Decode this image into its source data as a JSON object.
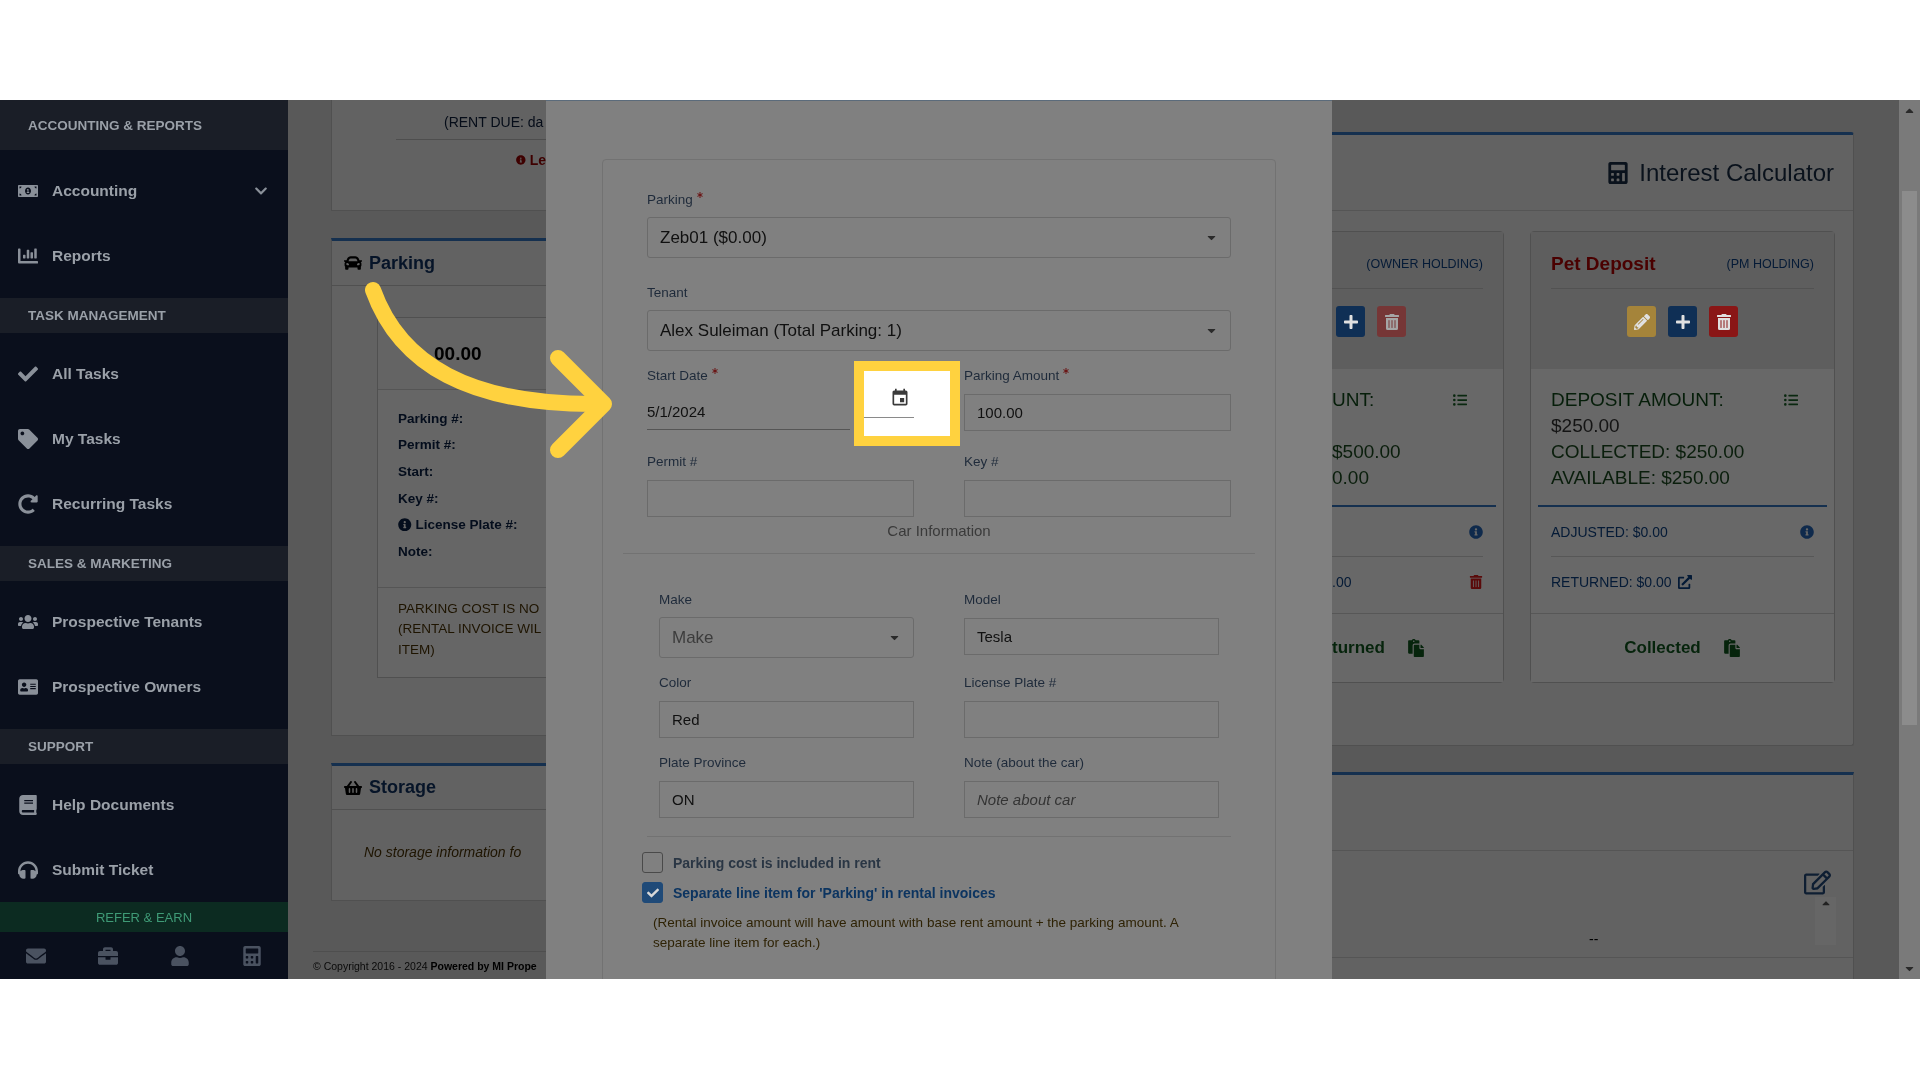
{
  "sidebar": {
    "sections": [
      {
        "title": "ACCOUNTING & REPORTS",
        "items": [
          {
            "label": "Accounting",
            "kind": "group"
          },
          {
            "label": "Reports",
            "kind": "link"
          }
        ]
      },
      {
        "title": "TASK MANAGEMENT",
        "items": [
          {
            "label": "All Tasks",
            "kind": "link"
          },
          {
            "label": "My Tasks",
            "kind": "link"
          },
          {
            "label": "Recurring Tasks",
            "kind": "link"
          }
        ]
      },
      {
        "title": "SALES & MARKETING",
        "items": [
          {
            "label": "Prospective Tenants",
            "kind": "link"
          },
          {
            "label": "Prospective Owners",
            "kind": "link"
          }
        ]
      },
      {
        "title": "SUPPORT",
        "items": [
          {
            "label": "Help Documents",
            "kind": "link"
          },
          {
            "label": "Submit Ticket",
            "kind": "link"
          }
        ]
      }
    ],
    "refer": "REFER & EARN"
  },
  "rent_card": {
    "rent_due": "(RENT DUE: da",
    "notice": "Le"
  },
  "parking_card": {
    "title": "Parking",
    "amount": "00.00",
    "fields": [
      {
        "label": "Parking #:",
        "kind": "plain"
      },
      {
        "label": "Permit #:",
        "kind": "plain"
      },
      {
        "label": "Start:",
        "kind": "plain"
      },
      {
        "label": "Key #:",
        "kind": "plain"
      },
      {
        "label": "License Plate #:",
        "kind": "info"
      },
      {
        "label": "Note:",
        "kind": "plain"
      }
    ],
    "warning_lines": [
      "PARKING COST IS NO",
      "(RENTAL INVOICE WIL",
      "ITEM)"
    ]
  },
  "storage_card": {
    "title": "Storage",
    "empty": "No storage information fo"
  },
  "footer": "© Copyright 2016 - 2024 **Powered by MI Prope**",
  "modal": {
    "top_fields": [
      {
        "label": "Parking",
        "required": true,
        "kind": "select",
        "value": "Zeb01 ($0.00)"
      },
      {
        "label": "Tenant",
        "required": false,
        "kind": "select",
        "value": "Alex Suleiman (Total Parking: 1)"
      }
    ],
    "row_fields": [
      {
        "label": "Start Date",
        "required": true,
        "kind": "date",
        "value": "5/1/2024"
      },
      {
        "label": "Parking Amount",
        "required": true,
        "kind": "input",
        "value": "100.00"
      },
      {
        "label": "Permit #",
        "required": false,
        "kind": "input"
      },
      {
        "label": "Key #",
        "required": false,
        "kind": "input"
      }
    ],
    "car_heading": "Car Information",
    "car_fields": [
      {
        "label": "Make",
        "kind": "select",
        "placeholder": "Make"
      },
      {
        "label": "Model",
        "kind": "input",
        "value": "Tesla"
      },
      {
        "label": "Color",
        "kind": "input",
        "value": "Red"
      },
      {
        "label": "License Plate #",
        "kind": "input"
      },
      {
        "label": "Plate Province",
        "kind": "input",
        "value": "ON"
      },
      {
        "label": "Note (about the car)",
        "kind": "input",
        "placeholder": "Note about car"
      }
    ],
    "options": [
      {
        "label": "Parking cost is included in rent",
        "checked": false
      },
      {
        "label": "Separate line item for 'Parking' in rental invoices",
        "checked": true
      }
    ],
    "option_note": "(Rental invoice amount will have amount with base rent amount + the parking amount. A separate line item for each.)"
  },
  "calculator": {
    "title": "Interest Calculator"
  },
  "deposits": [
    {
      "holding": "(OWNER HOLDING)",
      "buttons": [
        {
          "kind": "add",
          "disabled": false
        },
        {
          "kind": "delete",
          "disabled": true
        }
      ],
      "amount_label": "UNT:",
      "collected": "$500.00",
      "available": "0.00",
      "returned": {
        "kind": "delete",
        "text": ".00"
      },
      "footer": "turned"
    },
    {
      "title": "Pet Deposit",
      "holding": "(PM HOLDING)",
      "buttons": [
        {
          "kind": "edit",
          "disabled": false
        },
        {
          "kind": "add",
          "disabled": false
        },
        {
          "kind": "delete",
          "disabled": false
        }
      ],
      "amount_label": "DEPOSIT AMOUNT:",
      "amount_value": "$250.00",
      "collected": "COLLECTED: $250.00",
      "available": "AVAILABLE: $250.00",
      "adjusted": "ADJUSTED: $0.00",
      "returned": {
        "kind": "link",
        "text": "RETURNED: $0.00"
      },
      "footer": "Collected"
    }
  ],
  "notes_card": {
    "value": "--"
  }
}
